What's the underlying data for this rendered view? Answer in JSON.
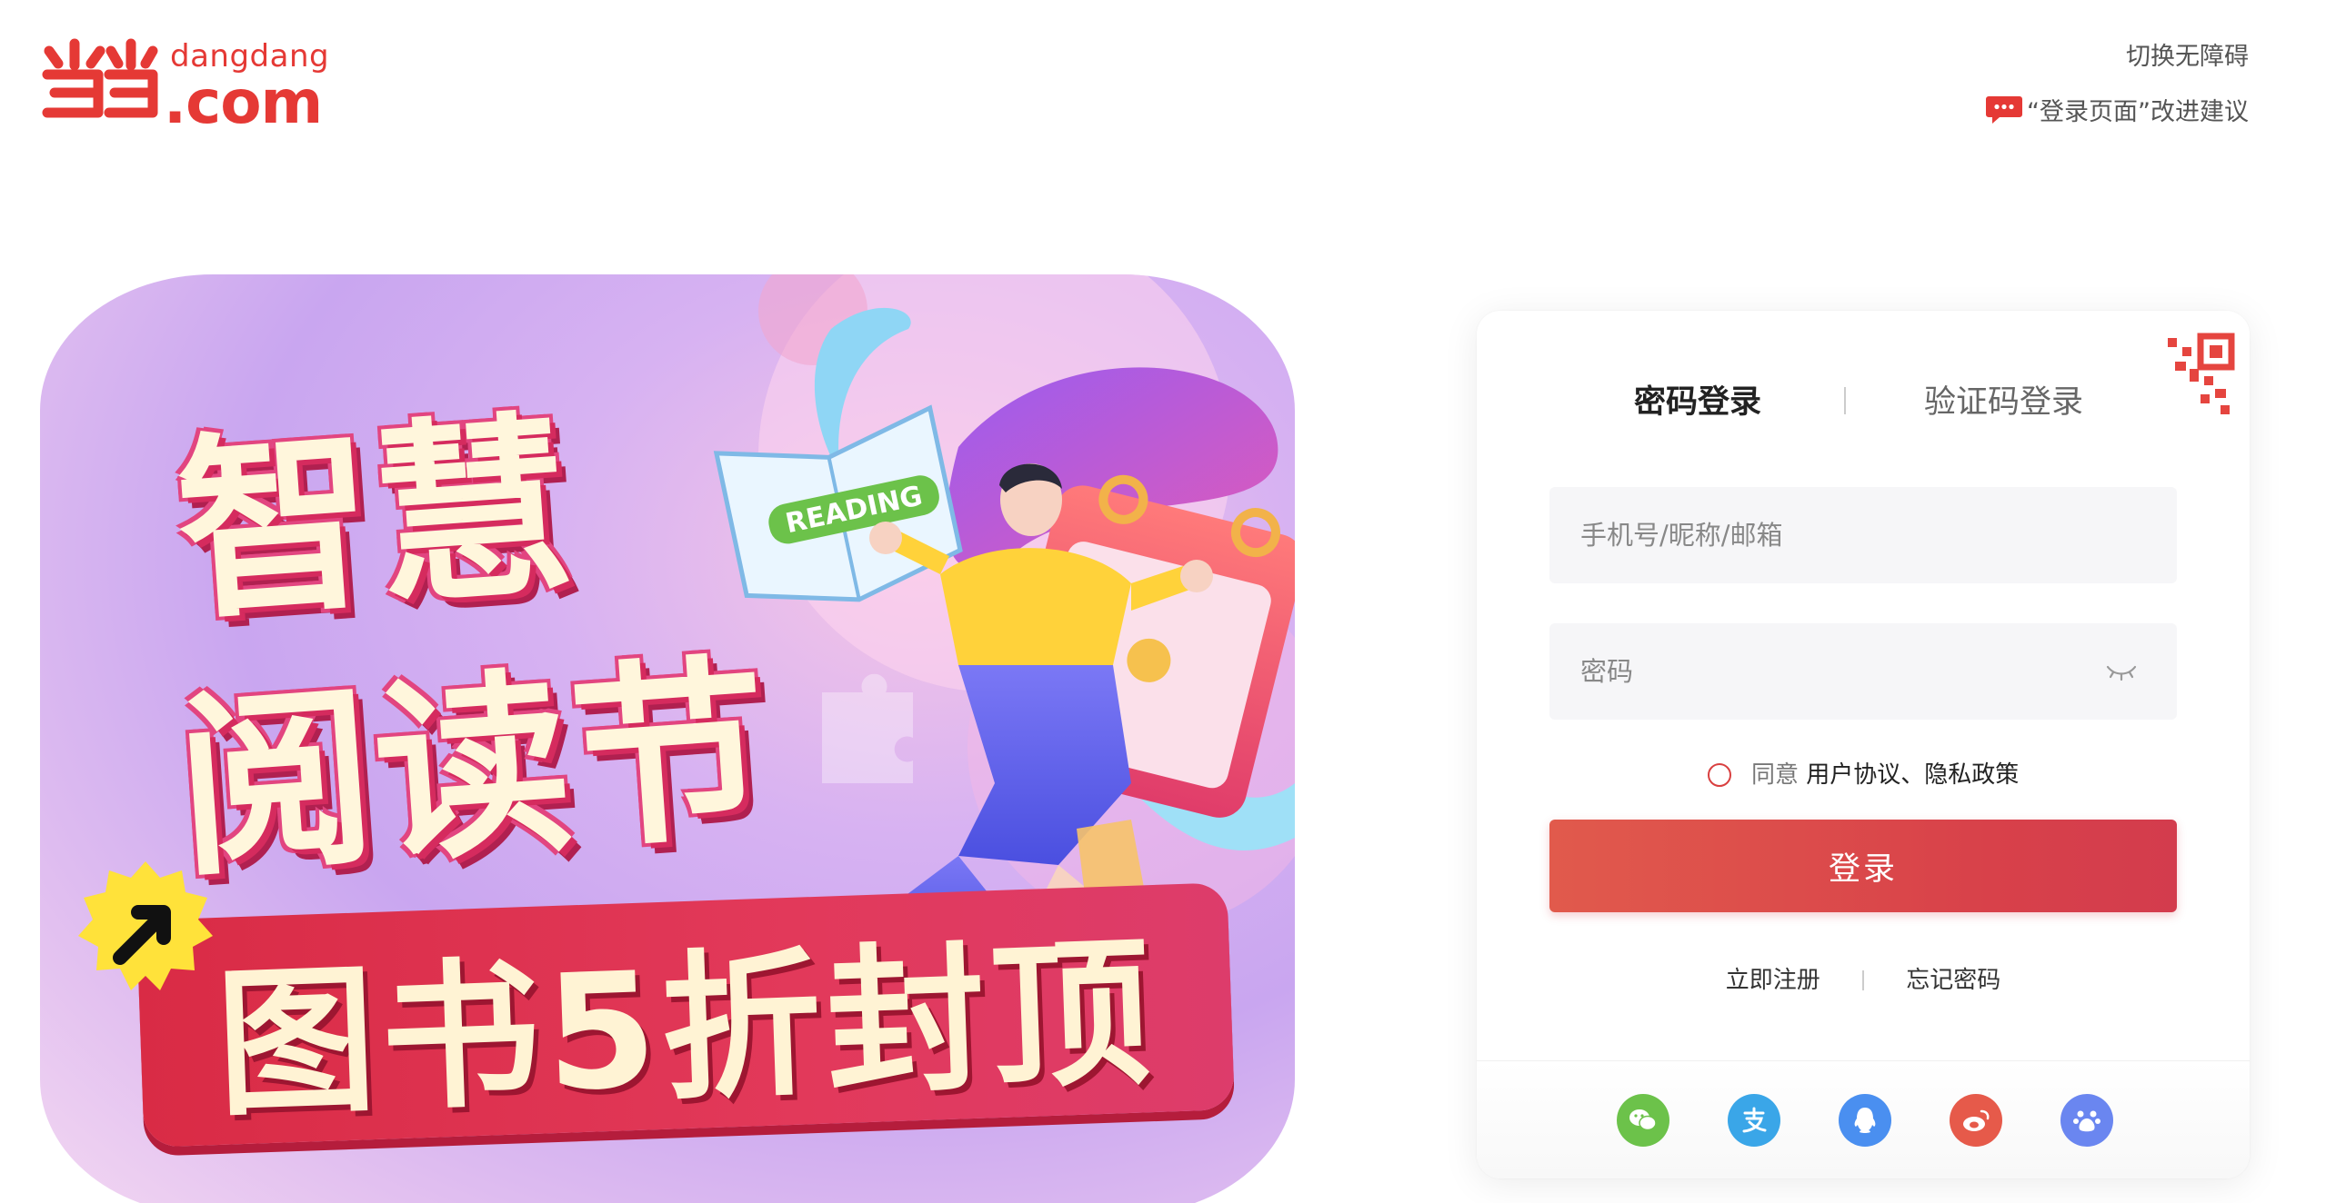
{
  "header": {
    "logo_sub": "dangdang",
    "logo_main": ".com",
    "accessibility_link": "切换无障碍",
    "feedback_link": "“登录页面”改进建议"
  },
  "banner": {
    "title_line1": "智慧",
    "title_line2": "阅读节",
    "book_label": "READING",
    "promo": "图书5折封顶"
  },
  "login": {
    "tab_password": "密码登录",
    "tab_code": "验证码登录",
    "username_placeholder": "手机号/昵称/邮箱",
    "password_placeholder": "密码",
    "agree_prefix": "同意",
    "agree_links": "用户协议、隐私政策",
    "submit": "登录",
    "register": "立即注册",
    "forgot": "忘记密码"
  },
  "social_logins": [
    {
      "icon": "wechat-icon",
      "color": "#6cc24a"
    },
    {
      "icon": "alipay-icon",
      "color": "#3aa6e8"
    },
    {
      "icon": "qq-icon",
      "color": "#4a8ff0"
    },
    {
      "icon": "weibo-icon",
      "color": "#e65a4a"
    },
    {
      "icon": "baidu-icon",
      "color": "#6a86f0"
    }
  ],
  "colors": {
    "brand": "#e53935",
    "button": "#d8414a"
  }
}
